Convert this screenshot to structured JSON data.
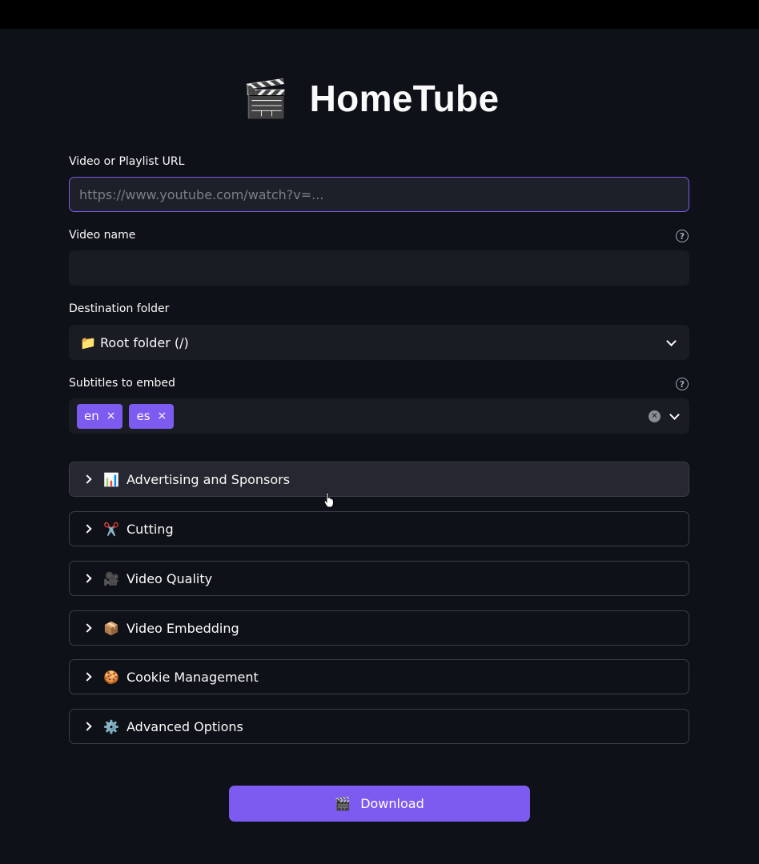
{
  "app": {
    "title": "HomeTube",
    "title_icon": "🎬"
  },
  "url_field": {
    "label": "Video or Playlist URL",
    "placeholder": "https://www.youtube.com/watch?v=...",
    "value": ""
  },
  "video_name": {
    "label": "Video name",
    "value": "",
    "help_icon": "question-circle-icon"
  },
  "destination": {
    "label": "Destination folder",
    "selected": "📁 Root folder (/)"
  },
  "subtitles": {
    "label": "Subtitles to embed",
    "help_icon": "question-circle-icon",
    "tags": [
      {
        "label": "en",
        "remove": "×"
      },
      {
        "label": "es",
        "remove": "×"
      }
    ]
  },
  "expanders": [
    {
      "icon": "📊",
      "label": "Advertising and Sponsors"
    },
    {
      "icon": "✂️",
      "label": "Cutting"
    },
    {
      "icon": "🎥",
      "label": "Video Quality"
    },
    {
      "icon": "📦",
      "label": "Video Embedding"
    },
    {
      "icon": "🍪",
      "label": "Cookie Management"
    },
    {
      "icon": "⚙️",
      "label": "Advanced Options"
    }
  ],
  "download_button": {
    "icon": "🎬",
    "label": "Download"
  },
  "colors": {
    "accent": "#7d5bf0",
    "background": "#0e1117",
    "field_bg": "#1a1c24"
  }
}
